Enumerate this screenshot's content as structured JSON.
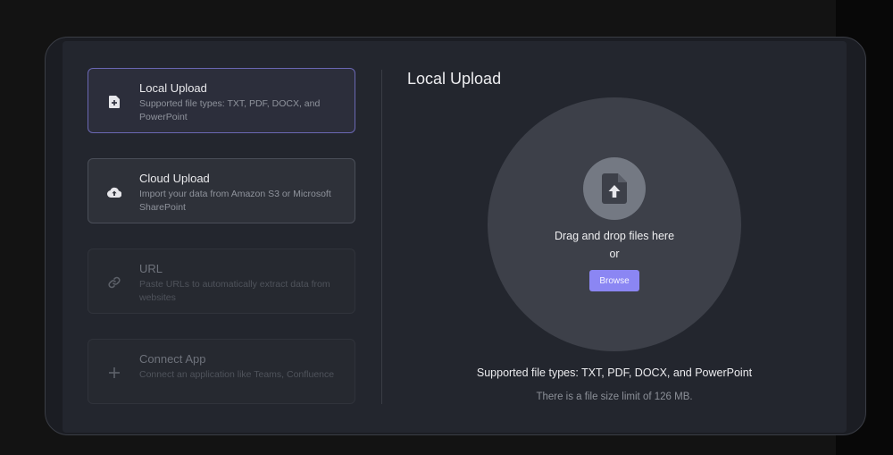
{
  "options": [
    {
      "title": "Local Upload",
      "description": "Supported file types: TXT, PDF, DOCX, and PowerPoint",
      "icon": "file-plus-icon",
      "state": "selected"
    },
    {
      "title": "Cloud Upload",
      "description": "Import your data from Amazon S3 or Microsoft SharePoint",
      "icon": "cloud-upload-icon",
      "state": "enabled"
    },
    {
      "title": "URL",
      "description": "Paste URLs to automatically extract data from websites",
      "icon": "link-icon",
      "state": "disabled"
    },
    {
      "title": "Connect App",
      "description": "Connect an application like Teams, Confluence",
      "icon": "plus-icon",
      "state": "disabled"
    }
  ],
  "main": {
    "heading": "Local Upload",
    "dropzone": {
      "icon": "file-upload-icon",
      "drag_text": "Drag and drop files here",
      "or_text": "or",
      "browse_label": "Browse"
    },
    "supported_text": "Supported file types: TXT, PDF, DOCX, and PowerPoint",
    "limit_text": "There is a file size limit of 126 MB."
  },
  "colors": {
    "accent": "#8b86f3",
    "selected_border": "#6a67b3",
    "panel_bg": "#23262e"
  }
}
